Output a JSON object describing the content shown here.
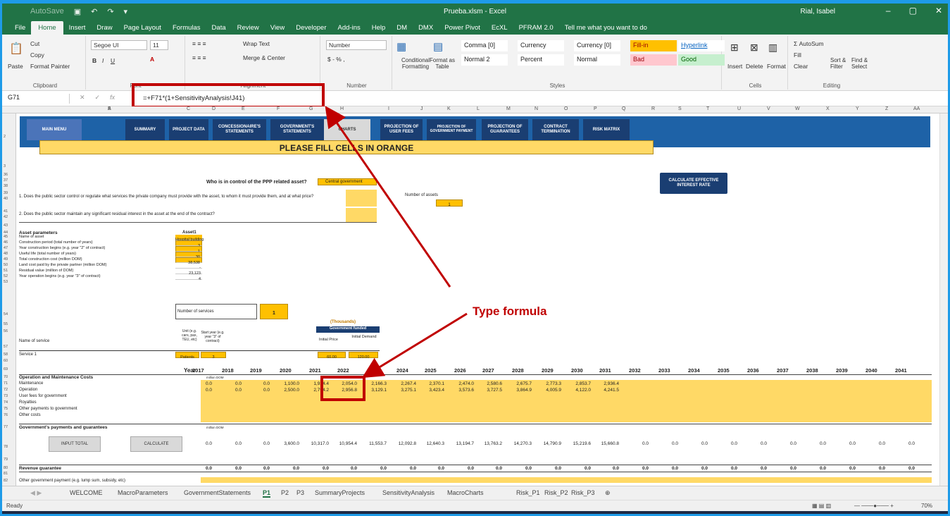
{
  "window": {
    "title": "Prueba.xlsm  -  Excel",
    "user": "Rial, Isabel",
    "autosave": "AutoSave"
  },
  "menu": [
    "File",
    "Home",
    "Insert",
    "Draw",
    "Page Layout",
    "Formulas",
    "Data",
    "Review",
    "View",
    "Developer",
    "Add-ins",
    "Help",
    "DM",
    "DMX",
    "Power Pivot",
    "EcXL",
    "PFRAM 2.0",
    "Tell me what you want to do"
  ],
  "ribbon": {
    "clipboard": {
      "paste": "Paste",
      "cut": "Cut",
      "copy": "Copy",
      "format_painter": "Format Painter",
      "name": "Clipboard"
    },
    "font": {
      "family": "Segoe UI",
      "size": "11",
      "name": "Font"
    },
    "alignment": {
      "wrap": "Wrap Text",
      "merge": "Merge & Center",
      "name": "Alignment"
    },
    "number": {
      "format": "Number",
      "name": "Number"
    },
    "styles": {
      "conditional": "Conditional Formatting",
      "format_table": "Format as Table",
      "items": [
        "Comma [0]",
        "Currency",
        "Currency [0]",
        "Fill-in",
        "Hyperlink",
        "Normal 2",
        "Percent",
        "Normal",
        "Bad",
        "Good"
      ],
      "name": "Styles"
    },
    "cells": {
      "insert": "Insert",
      "delete": "Delete",
      "format": "Format",
      "name": "Cells"
    },
    "editing": {
      "autosum": "AutoSum",
      "fill": "Fill",
      "clear": "Clear",
      "sort": "Sort & Filter",
      "find": "Find & Select",
      "name": "Editing"
    }
  },
  "formula_bar": {
    "name_box": "G71",
    "formula": "=+F71*(1+SensitivityAnalysis!J41)"
  },
  "columns": [
    "A",
    "B",
    "C",
    "D",
    "E",
    "F",
    "G",
    "H",
    "I",
    "J",
    "K",
    "L",
    "M",
    "N",
    "O",
    "P",
    "Q",
    "R",
    "S",
    "T",
    "U",
    "V",
    "W",
    "X",
    "Y",
    "Z",
    "AA"
  ],
  "nav": {
    "main_menu": "MAIN MENU",
    "summary": "SUMMARY",
    "project_data": "PROJECT DATA",
    "concessionaire": "CONCESSIONAIRE'S STATEMENTS",
    "government": "GOVERNMENT'S STATEMENTS",
    "charts": "CHARTS",
    "user_fees": "PROJECTION OF USER FEES",
    "gov_payment": "PROJECTION OF GOVERNMENT PAYMENT",
    "guarantees": "PROJECTION OF GUARANTEES",
    "termination": "CONTRACT TERMINATION",
    "risk": "RISK MATRIX"
  },
  "banner": "PLEASE FILL CELLS IN ORANGE",
  "control": {
    "question": "Who is in control of the PPP related asset?",
    "answer": "Central government"
  },
  "q1": "1. Does the public sector control or regulate what services the private company must provide with the asset, to whom it must provide them, and at what price?",
  "q2": "2. Does the public sector maintain any significant residual interest in the asset at the end of the contract?",
  "assets": {
    "label": "Number of assets",
    "value": "1"
  },
  "effective_btn": "CALCULATE EFFECTIVE INTEREST RATE",
  "asset_params": {
    "title": "Asset parameters",
    "col": "Asset1",
    "rows": [
      {
        "label": "Name of asset",
        "value": "Hospital building"
      },
      {
        "label": "Construction period (total number of years)",
        "value": "3"
      },
      {
        "label": "Year construction begins (e.g. year \"2\" of contract)",
        "value": "1"
      },
      {
        "label": "Useful life (total number of years)",
        "value": "30"
      },
      {
        "label": "Total construction cost (million DOM)",
        "value": "38,538"
      },
      {
        "label": "Land cost paid by the private partner (million DOM)",
        "value": "-"
      },
      {
        "label": "Residual value (million of DOM)",
        "value": "23,123"
      },
      {
        "label": "Year operation begins (e.g. year \"3\" of contract)",
        "value": "4"
      }
    ]
  },
  "services": {
    "label": "Number of services",
    "value": "1"
  },
  "service_table": {
    "name_hdr": "Name of service",
    "unit_hdr": "Unit (e.g. cars, pax, TEU, etc)",
    "start_hdr": "Start year (e.g. year \"3\" of contract)",
    "thousands": "(Thousands)",
    "gov_funded": "Government funded",
    "initial_price": "Initial Price",
    "initial_demand": "Initial Demand",
    "row": {
      "name": "Service 1",
      "unit": "Patients",
      "start": "3",
      "price": "60.00",
      "demand": "120.00"
    }
  },
  "years_label": "Year",
  "years": [
    "2017",
    "2018",
    "2019",
    "2020",
    "2021",
    "2022",
    "2023",
    "2024",
    "2025",
    "2026",
    "2027",
    "2028",
    "2029",
    "2030",
    "2031",
    "2032",
    "2033",
    "2034",
    "2035",
    "2036",
    "2037",
    "2038",
    "2039",
    "2040",
    "2041"
  ],
  "om": {
    "title": "Operation and Maintenance Costs",
    "unit": "million DOM",
    "maintenance": {
      "label": "Maintenance",
      "values": [
        "0.0",
        "0.0",
        "0.0",
        "1,100.0",
        "1,934.4",
        "2,054.0",
        "2,166.3",
        "2,267.4",
        "2,370.1",
        "2,474.0",
        "2,580.6",
        "2,675.7",
        "2,773.3",
        "2,853.7",
        "2,936.4"
      ]
    },
    "operation": {
      "label": "Operation",
      "values": [
        "0.0",
        "0.0",
        "0.0",
        "2,500.0",
        "2,794.2",
        "2,956.8",
        "3,129.1",
        "3,275.1",
        "3,423.4",
        "3,573.6",
        "3,727.5",
        "3,864.9",
        "4,005.9",
        "4,122.0",
        "4,241.5"
      ]
    },
    "others": [
      "User fees for government",
      "Royalties",
      "Other payments to government",
      "Other costs"
    ]
  },
  "gov_payments": {
    "title": "Government's payments and guarantees",
    "unit": "million DOM",
    "input_btn": "INPUT TOTAL",
    "calc_btn": "CALCULATE",
    "values": [
      "0.0",
      "0.0",
      "0.0",
      "3,600.0",
      "10,317.0",
      "10,954.4",
      "11,553.7",
      "12,092.8",
      "12,640.3",
      "13,194.7",
      "13,763.2",
      "14,270.3",
      "14,790.9",
      "15,219.6",
      "15,660.8",
      "0.0",
      "0.0",
      "0.0",
      "0.0",
      "0.0",
      "0.0",
      "0.0",
      "0.0",
      "0.0",
      "0.0"
    ]
  },
  "revenue": {
    "title": "Revenue guarantee",
    "values": [
      "0.0",
      "0.0",
      "0.0",
      "0.0",
      "0.0",
      "0.0",
      "0.0",
      "0.0",
      "0.0",
      "0.0",
      "0.0",
      "0.0",
      "0.0",
      "0.0",
      "0.0",
      "0.0",
      "0.0",
      "0.0",
      "0.0",
      "0.0",
      "0.0",
      "0.0",
      "0.0",
      "0.0",
      "0.0"
    ]
  },
  "other_gov": "Other government payment (e.g. lump sum, subsidy, etc)",
  "callout": "Type formula",
  "sheet_tabs": [
    "WELCOME",
    "MacroParameters",
    "GovernmentStatements",
    "P1",
    "P2",
    "P3",
    "SummaryProjects",
    "SensitivityAnalysis",
    "MacroCharts",
    "Risk_P1",
    "Risk_P2",
    "Risk_P3"
  ],
  "active_tab": "P1",
  "status": {
    "ready": "Ready",
    "zoom": "70%"
  }
}
